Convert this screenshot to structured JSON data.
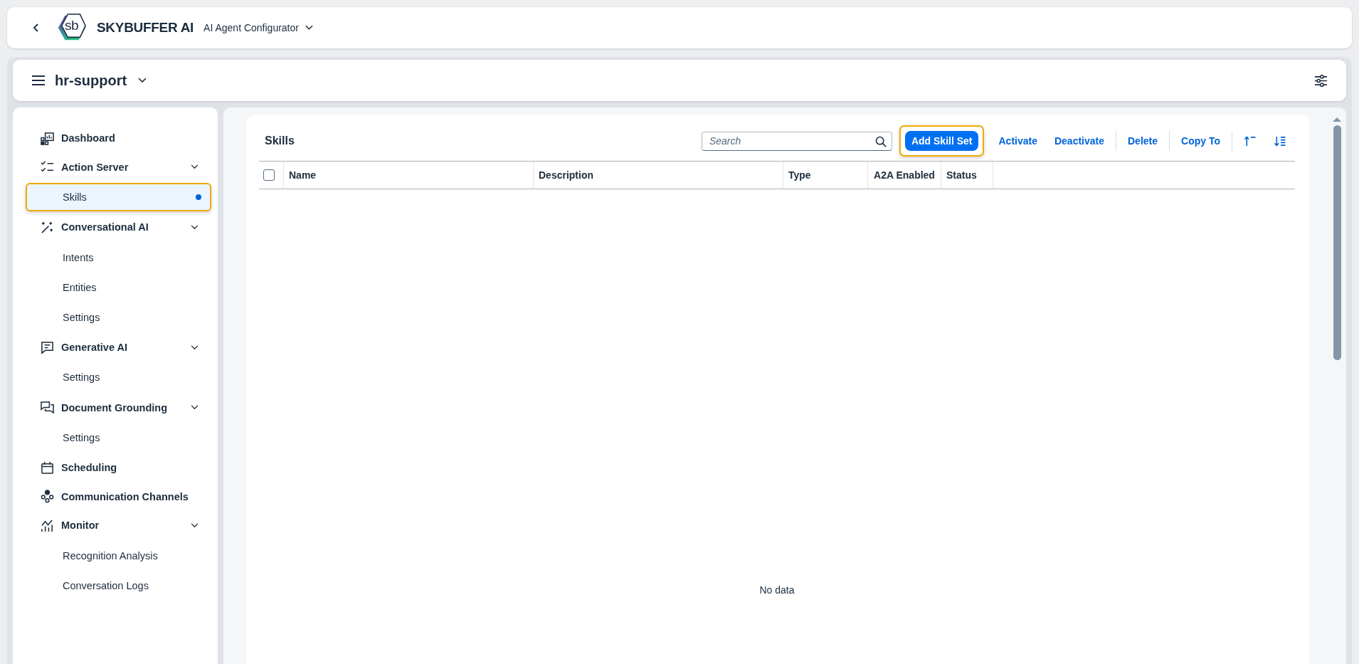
{
  "header": {
    "logo_text": "sb",
    "brand": "SKYBUFFER AI",
    "app_title": "AI Agent Configurator"
  },
  "workspace": {
    "name": "hr-support"
  },
  "sidebar": {
    "items": [
      {
        "label": "Dashboard"
      },
      {
        "label": "Action Server",
        "expanded": true,
        "children": [
          {
            "label": "Skills",
            "selected": true,
            "highlighted": true
          }
        ]
      },
      {
        "label": "Conversational AI",
        "expanded": true,
        "children": [
          {
            "label": "Intents",
            "selected": false,
            "highlighted": false
          },
          {
            "label": "Entities",
            "selected": false,
            "highlighted": false
          },
          {
            "label": "Settings",
            "selected": false,
            "highlighted": false
          }
        ]
      },
      {
        "label": "Generative AI",
        "expanded": true,
        "children": [
          {
            "label": "Settings",
            "selected": false,
            "highlighted": false
          }
        ]
      },
      {
        "label": "Document Grounding",
        "expanded": true,
        "children": [
          {
            "label": "Settings",
            "selected": false,
            "highlighted": false
          }
        ]
      },
      {
        "label": "Scheduling"
      },
      {
        "label": "Communication Channels"
      },
      {
        "label": "Monitor",
        "expanded": true,
        "children": [
          {
            "label": "Recognition Analysis",
            "selected": false,
            "highlighted": false
          },
          {
            "label": "Conversation Logs",
            "selected": false,
            "highlighted": false
          }
        ]
      }
    ]
  },
  "skills": {
    "title": "Skills",
    "search": {
      "placeholder": "Search"
    },
    "toolbar": [
      {
        "kind": "primary",
        "label": "Add Skill Set",
        "highlighted": true
      },
      {
        "kind": "text",
        "label": "Activate",
        "highlighted": false
      },
      {
        "kind": "text",
        "label": "Deactivate",
        "highlighted": false
      },
      {
        "kind": "separator"
      },
      {
        "kind": "text",
        "label": "Delete",
        "highlighted": false
      },
      {
        "kind": "separator"
      },
      {
        "kind": "text",
        "label": "Copy To",
        "highlighted": false
      },
      {
        "kind": "separator"
      },
      {
        "kind": "sort-ascending"
      },
      {
        "kind": "sort-descending"
      }
    ],
    "table": {
      "select_all": {
        "checked": false
      },
      "columns": [
        "Name",
        "Description",
        "Type",
        "A2A Enabled",
        "Status"
      ],
      "empty_text": "No data"
    }
  }
}
